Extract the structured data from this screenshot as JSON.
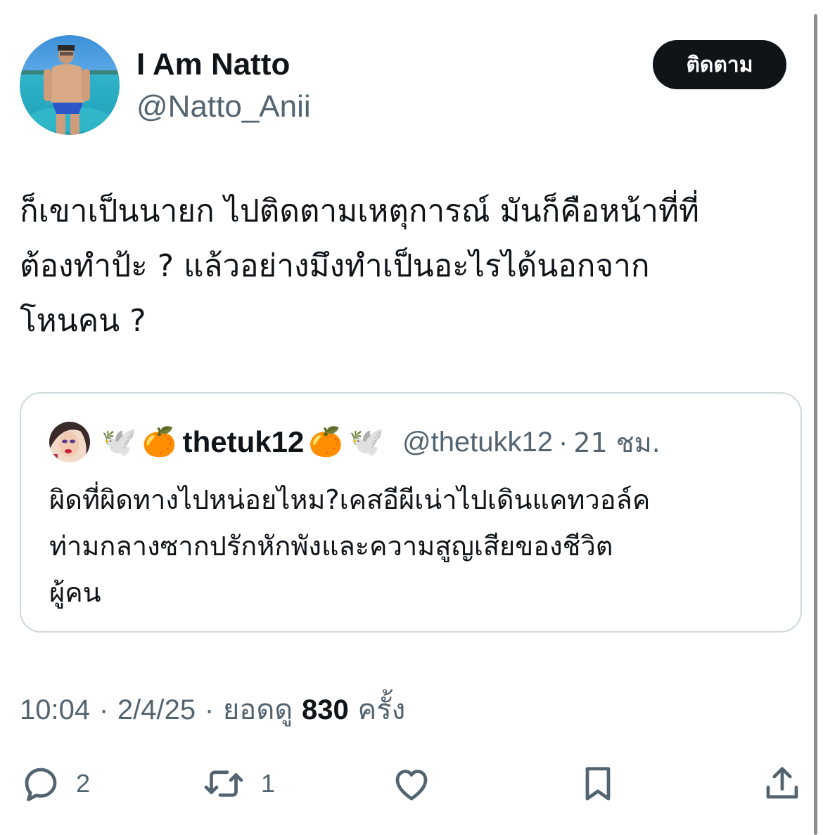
{
  "author": {
    "display_name": "I Am Natto",
    "handle": "@Natto_Anii",
    "follow_label": "ติดตาม"
  },
  "tweet": {
    "lines": [
      "ก็เขาเป็นนายก ไปติดตามเหตุการณ์ มันก็คือหน้าที่ที่",
      "ต้องทำป้ะ ? แล้วอย่างมึงทำเป็นอะไรได้นอกจาก",
      "โหนคน ?"
    ]
  },
  "quote": {
    "emoji_1": "🕊️",
    "emoji_2": "🍊",
    "name": "thetuk12",
    "emoji_3": "🍊",
    "emoji_4": "🕊️",
    "handle": "@thetukk12",
    "separator": "·",
    "time": "21 ชม.",
    "lines": [
      "ผิดที่ผิดทางไปหน่อยไหม?เคสอีผีเน่าไปเดินแคทวอล์ค",
      "ท่ามกลางซากปรักหักพังและความสูญเสียของชีวิต",
      "ผู้คน"
    ]
  },
  "meta": {
    "time": "10:04",
    "separator": "·",
    "date": "2/4/25",
    "views_label": "ยอดดู",
    "views_count": "830",
    "views_unit": "ครั้ง"
  },
  "actions": {
    "reply_icon": "reply-icon",
    "reply_count": "2",
    "retweet_icon": "retweet-icon",
    "retweet_count": "1",
    "like_icon": "like-icon",
    "bookmark_icon": "bookmark-icon",
    "share_icon": "share-icon"
  },
  "colors": {
    "text_primary": "#0f1419",
    "text_secondary": "#536471",
    "border": "#cfd9de",
    "follow_bg": "#0f1419"
  }
}
